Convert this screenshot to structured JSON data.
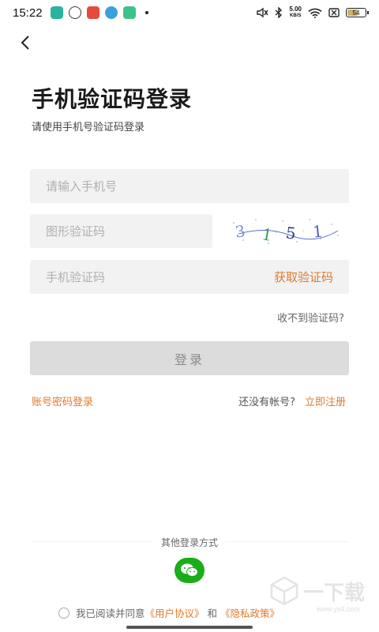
{
  "status_bar": {
    "time": "15:22",
    "net_speed_value": "5.00",
    "net_speed_unit": "KB/S",
    "battery_level": "54",
    "app_icons": [
      "#2bb3a0",
      "#3a3a3a",
      "#e64a3c",
      "#3aa0e0",
      "#3cc38a"
    ]
  },
  "nav": {
    "back_icon": "chevron-left-icon"
  },
  "header": {
    "title": "手机验证码登录",
    "subtitle": "请使用手机号验证码登录"
  },
  "form": {
    "phone_placeholder": "请输入手机号",
    "captcha_placeholder": "图形验证码",
    "captcha_text": "3 1 5 1",
    "sms_placeholder": "手机验证码",
    "get_code_label": "获取验证码",
    "no_code_label": "收不到验证码?",
    "login_label": "登录"
  },
  "links": {
    "password_login": "账号密码登录",
    "no_account": "还没有帐号?",
    "register": "立即注册"
  },
  "other_login": {
    "title": "其他登录方式",
    "wechat_icon": "wechat-icon"
  },
  "agreement": {
    "prefix": "我已阅读并同意",
    "user_agreement": "《用户协议》",
    "and": "和",
    "privacy_policy": "《隐私政策》"
  },
  "watermark": {
    "text": "一下载",
    "sub": "www.yx4.com"
  },
  "colors": {
    "accent": "#e07a2e",
    "input_bg": "#f2f2f2",
    "button_disabled": "#dcdcdc",
    "wechat": "#1aad19"
  }
}
